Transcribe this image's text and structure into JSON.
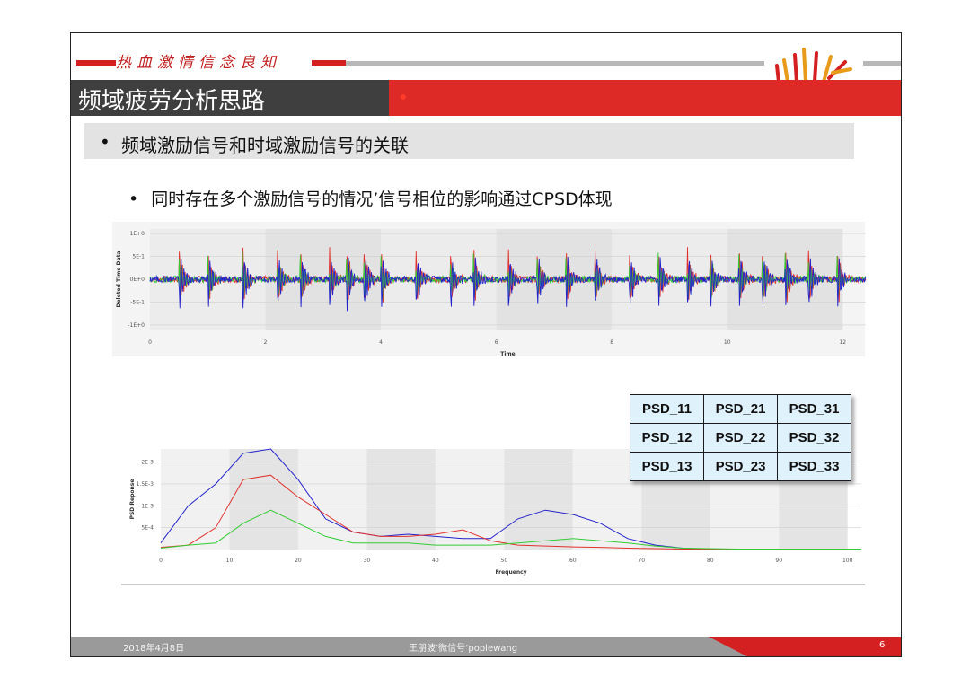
{
  "header": {
    "motto": "热血激情信念良知",
    "title": "频域疲劳分析思路"
  },
  "bullets": {
    "level1": "频域激励信号和时域激励信号的关联",
    "level2": "同时存在多个激励信号的情况’信号相位的影响通过CPSD体现"
  },
  "colors": {
    "accent_red": "#dd2a27",
    "title_dark": "#3f3f3f",
    "series_red": "#e0332e",
    "series_green": "#33cc33",
    "series_blue": "#2222cc"
  },
  "psd_table": [
    [
      "PSD_11",
      "PSD_21",
      "PSD_31"
    ],
    [
      "PSD_12",
      "PSD_22",
      "PSD_32"
    ],
    [
      "PSD_13",
      "PSD_23",
      "PSD_33"
    ]
  ],
  "chart_data": [
    {
      "type": "line",
      "xlabel": "Time",
      "ylabel": "Deleted Time Data",
      "xlim": [
        0,
        12.4
      ],
      "ylim": [
        -1.1,
        1.1
      ],
      "xticks": [
        "0",
        "2",
        "4",
        "6",
        "8",
        "10",
        "12"
      ],
      "yticks": [
        "1E+0",
        "5E-1",
        "0E+0",
        "-5E-1",
        "-1E+0"
      ],
      "ytick_values": [
        1,
        0.5,
        0,
        -0.5,
        -1
      ],
      "series": [
        {
          "color": "#e0332e"
        },
        {
          "color": "#33cc33"
        },
        {
          "color": "#2222cc"
        }
      ]
    },
    {
      "type": "line",
      "xlabel": "Frequency",
      "ylabel": "PSD Reponse",
      "xlim": [
        0,
        102
      ],
      "ylim": [
        0,
        0.0023
      ],
      "xticks": [
        "0",
        "10",
        "20",
        "30",
        "40",
        "50",
        "60",
        "70",
        "80",
        "90",
        "100"
      ],
      "yticks": [
        "2E-3",
        "1.5E-3",
        "1E-3",
        "5E-4"
      ],
      "ytick_values": [
        0.002,
        0.0015,
        0.001,
        0.0005
      ],
      "x": [
        0,
        4,
        8,
        12,
        16,
        20,
        24,
        28,
        32,
        36,
        40,
        44,
        48,
        52,
        56,
        60,
        64,
        68,
        72,
        76,
        80,
        84,
        88,
        92,
        96,
        100,
        102
      ],
      "series": [
        {
          "color": "#2222cc",
          "values": [
            0.00015,
            0.001,
            0.0015,
            0.0022,
            0.0023,
            0.0016,
            0.0007,
            0.0004,
            0.0003,
            0.00035,
            0.0003,
            0.00025,
            0.00025,
            0.0007,
            0.0009,
            0.0008,
            0.0006,
            0.00025,
            0.0001,
            3e-05,
            1e-05,
            1e-05,
            1e-05,
            1e-05,
            1e-05,
            1e-05,
            1e-05
          ]
        },
        {
          "color": "#e0332e",
          "values": [
            5e-05,
            0.0001,
            0.0005,
            0.0016,
            0.0017,
            0.0012,
            0.0008,
            0.0004,
            0.0003,
            0.0003,
            0.00035,
            0.00045,
            0.0002,
            0.0001,
            8e-05,
            6e-05,
            5e-05,
            3e-05,
            2e-05,
            1e-05,
            1e-05,
            1e-05,
            1e-05,
            1e-05,
            1e-05,
            1e-05,
            1e-05
          ]
        },
        {
          "color": "#33cc33",
          "values": [
            3e-05,
            0.0001,
            0.00015,
            0.0006,
            0.0009,
            0.0006,
            0.0003,
            0.00015,
            0.00015,
            0.00015,
            0.0001,
            0.0001,
            0.0001,
            0.00015,
            0.0002,
            0.00025,
            0.0002,
            0.00015,
            8e-05,
            3e-05,
            2e-05,
            1e-05,
            1e-05,
            1e-05,
            1e-05,
            1e-05,
            1e-05
          ]
        }
      ]
    }
  ],
  "footer": {
    "date": "2018年4月8日",
    "author": "王朋波’微信号’poplewang",
    "page": "6"
  }
}
